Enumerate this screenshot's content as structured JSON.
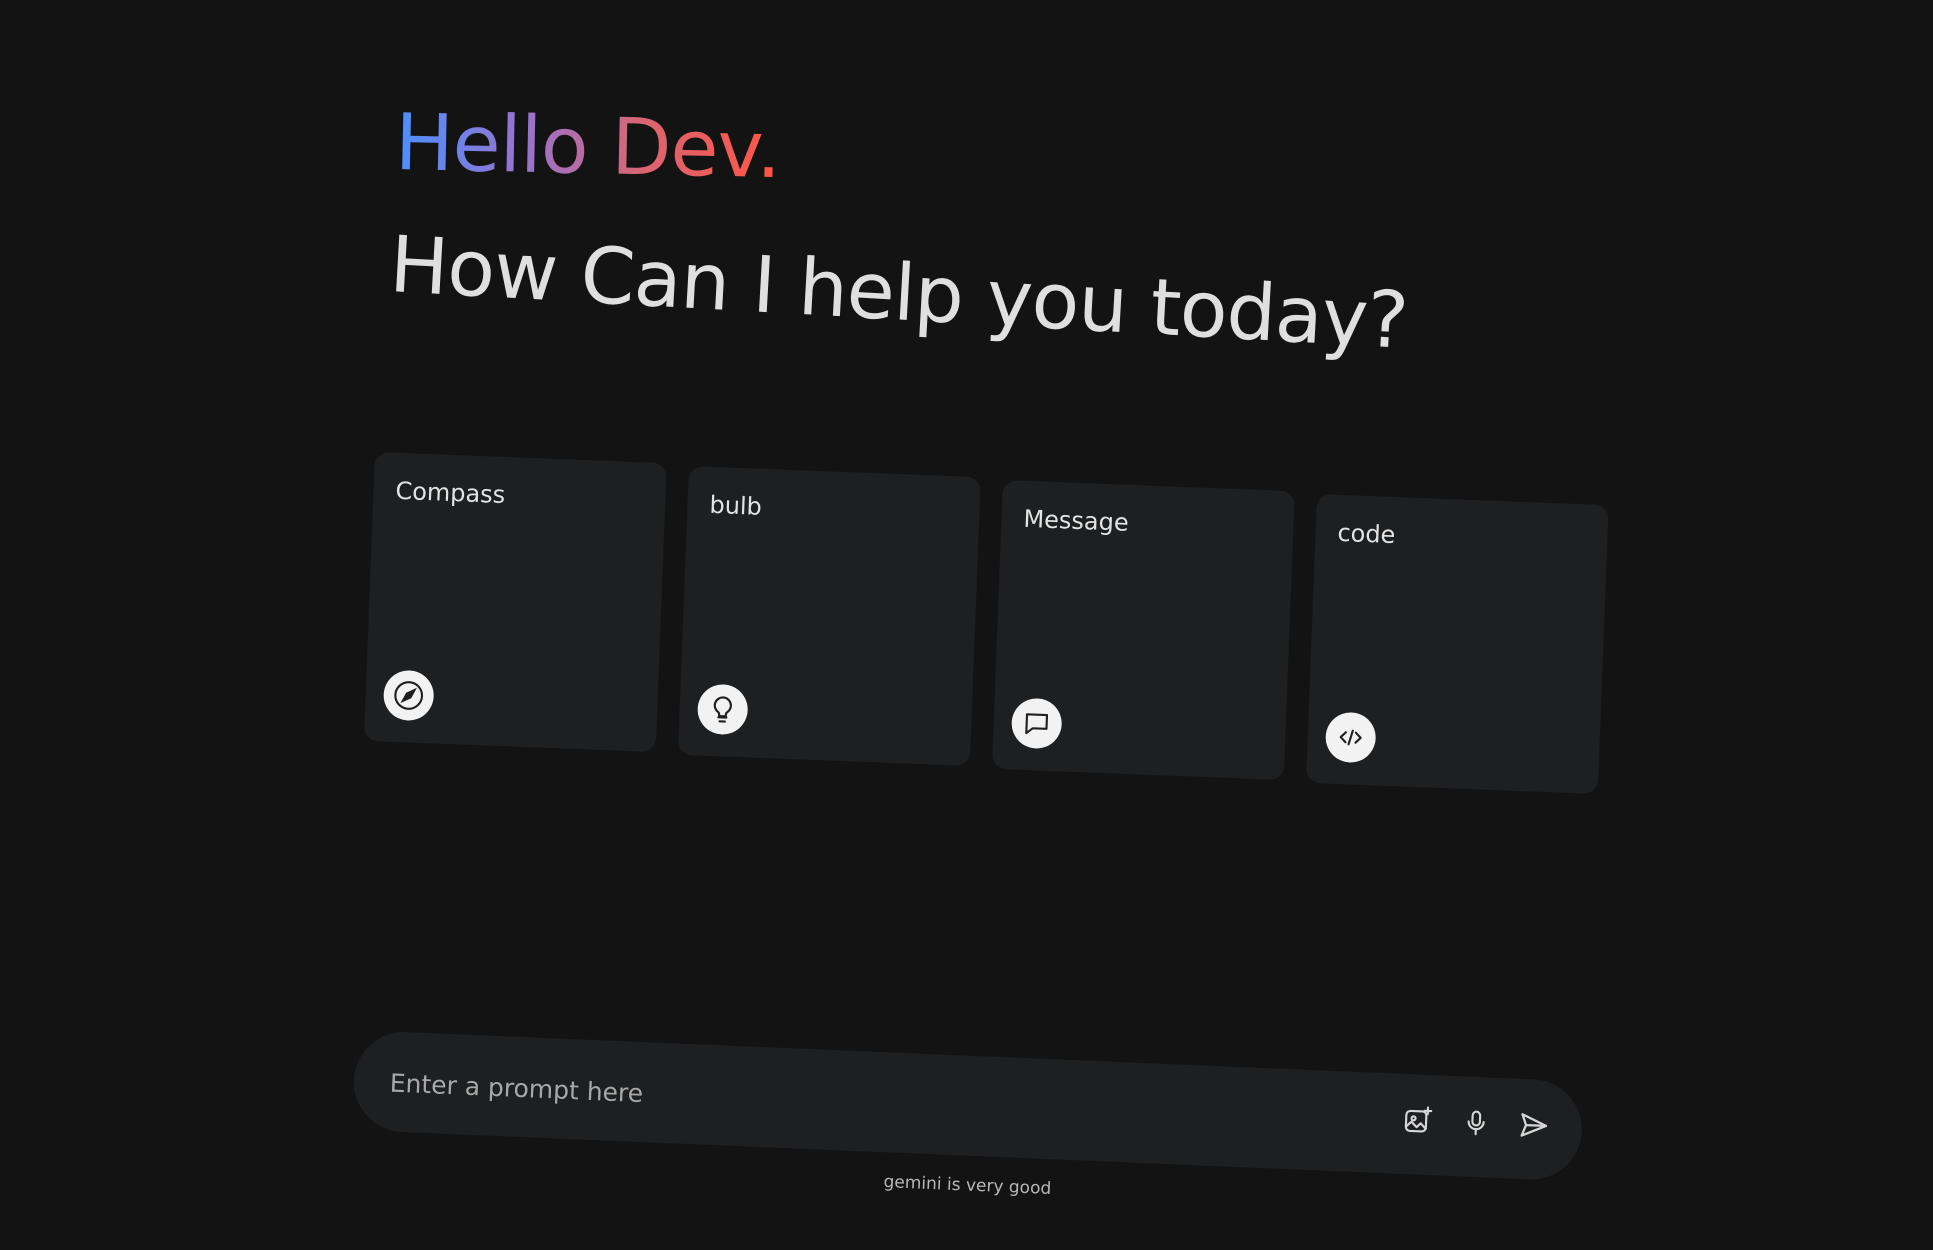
{
  "greeting": {
    "title": "Hello Dev.",
    "subtitle": "How Can I help you today?",
    "gradient_colors": [
      "#4b90ff",
      "#9b72cb",
      "#d96570",
      "#ff5546"
    ]
  },
  "cards": [
    {
      "label": "Compass",
      "icon": "compass-icon"
    },
    {
      "label": "bulb",
      "icon": "bulb-icon"
    },
    {
      "label": "Message",
      "icon": "message-icon"
    },
    {
      "label": "code",
      "icon": "code-icon"
    }
  ],
  "prompt": {
    "placeholder": "Enter a prompt here",
    "value": "",
    "actions": [
      "gallery-icon",
      "mic-icon",
      "send-icon"
    ]
  },
  "footer": {
    "note": "gemini is very good"
  },
  "colors": {
    "background": "#131314",
    "surface": "#1e1f20",
    "text": "#e3e3e3",
    "icon_background": "#f2f2f2"
  }
}
